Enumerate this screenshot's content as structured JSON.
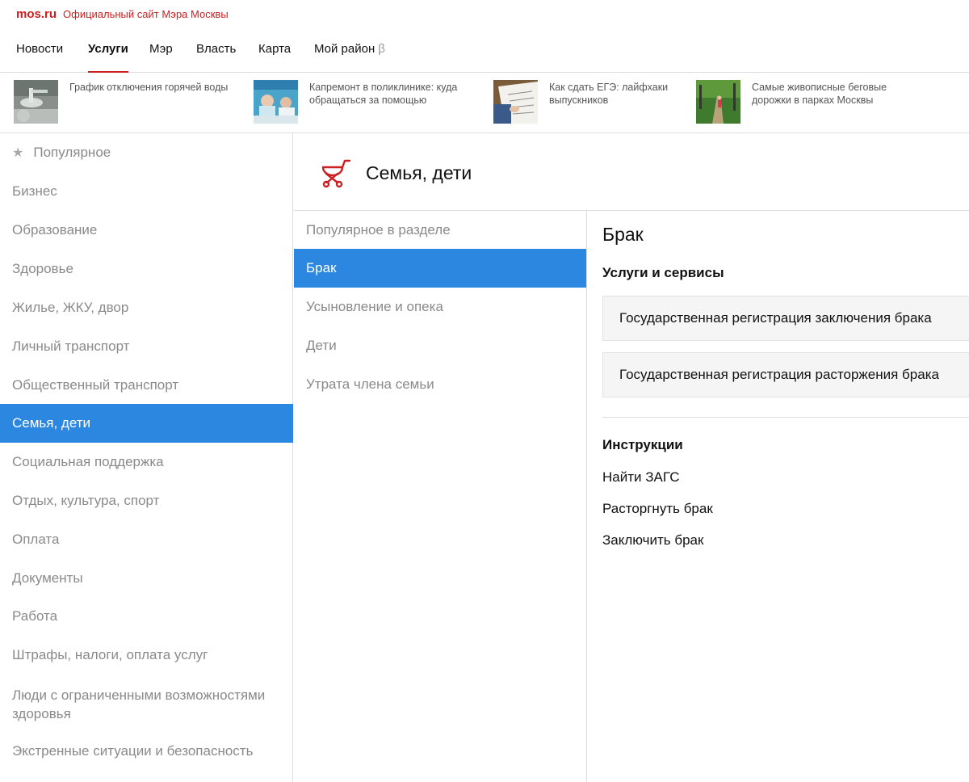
{
  "header": {
    "logo": "mos.ru",
    "tagline": "Официальный сайт Мэра Москвы"
  },
  "nav": {
    "items": [
      {
        "label": "Новости"
      },
      {
        "label": "Услуги"
      },
      {
        "label": "Мэр"
      },
      {
        "label": "Власть"
      },
      {
        "label": "Карта"
      },
      {
        "label": "Мой район"
      }
    ],
    "active": "Услуги",
    "beta": "β"
  },
  "news": [
    {
      "title": "График отключения горячей воды",
      "image": "faucet-photo"
    },
    {
      "title": "Капремонт в поликлинике: куда обращаться за помощью",
      "image": "clinic-photo"
    },
    {
      "title": "Как сдать ЕГЭ: лайфхаки выпускников",
      "image": "exam-photo"
    },
    {
      "title": "Самые живописные беговые дорожки в парках Москвы",
      "image": "park-path-photo"
    }
  ],
  "sidebar": {
    "items": [
      {
        "label": "Популярное",
        "icon": "star-icon"
      },
      {
        "label": "Бизнес"
      },
      {
        "label": "Образование"
      },
      {
        "label": "Здоровье"
      },
      {
        "label": "Жилье, ЖКУ, двор"
      },
      {
        "label": "Личный транспорт"
      },
      {
        "label": "Общественный транспорт"
      },
      {
        "label": "Семья, дети"
      },
      {
        "label": "Социальная поддержка"
      },
      {
        "label": "Отдых, культура, спорт"
      },
      {
        "label": "Оплата"
      },
      {
        "label": "Документы"
      },
      {
        "label": "Работа"
      },
      {
        "label": "Штрафы, налоги, оплата услуг"
      },
      {
        "label": "Люди с ограниченными возможностями здоровья"
      },
      {
        "label": "Экстренные ситуации и безопасность"
      }
    ],
    "active": "Семья, дети"
  },
  "section": {
    "title": "Семья, дети",
    "icon": "stroller-icon"
  },
  "submenu": {
    "items": [
      {
        "label": "Популярное в разделе"
      },
      {
        "label": "Брак"
      },
      {
        "label": "Усыновление и опека"
      },
      {
        "label": "Дети"
      },
      {
        "label": "Утрата члена семьи"
      }
    ],
    "active": "Брак"
  },
  "content": {
    "title": "Брак",
    "services_heading": "Услуги и сервисы",
    "services": [
      {
        "label": "Государственная регистрация заключения брака"
      },
      {
        "label": "Государственная регистрация расторжения брака"
      }
    ],
    "instructions_heading": "Инструкции",
    "instructions": [
      {
        "label": "Найти ЗАГС"
      },
      {
        "label": "Расторгнуть брак"
      },
      {
        "label": "Заключить брак"
      }
    ]
  },
  "colors": {
    "brand": "#cc1f1f",
    "active_bg": "#2b87e0"
  }
}
